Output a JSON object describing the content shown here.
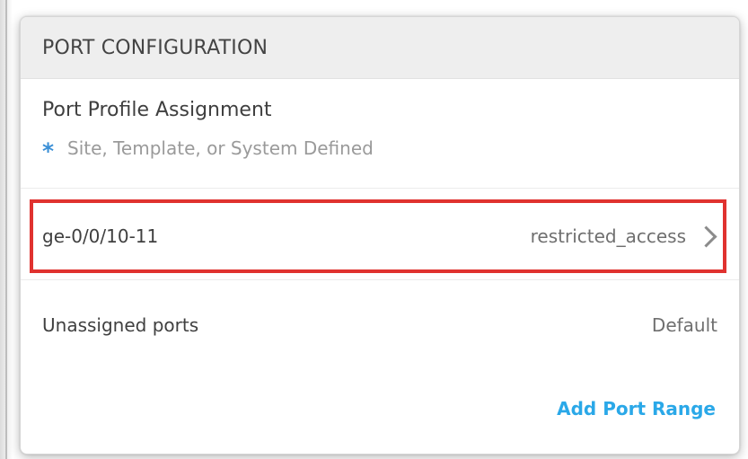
{
  "panel": {
    "header_title": "PORT CONFIGURATION",
    "section_title": "Port Profile Assignment",
    "legend_text": "Site, Template, or System Defined",
    "legend_icon": "asterisk-icon"
  },
  "rows": [
    {
      "label": "ge-0/0/10-11",
      "value": "restricted_access",
      "highlighted": true,
      "icon": "chevron-right-icon"
    },
    {
      "label": "Unassigned ports",
      "value": "Default",
      "highlighted": false
    }
  ],
  "actions": {
    "add_port_range": "Add Port Range"
  },
  "colors": {
    "accent": "#2aa8e8",
    "highlight_border": "#e0322f",
    "legend_star": "#3a8fd6"
  }
}
